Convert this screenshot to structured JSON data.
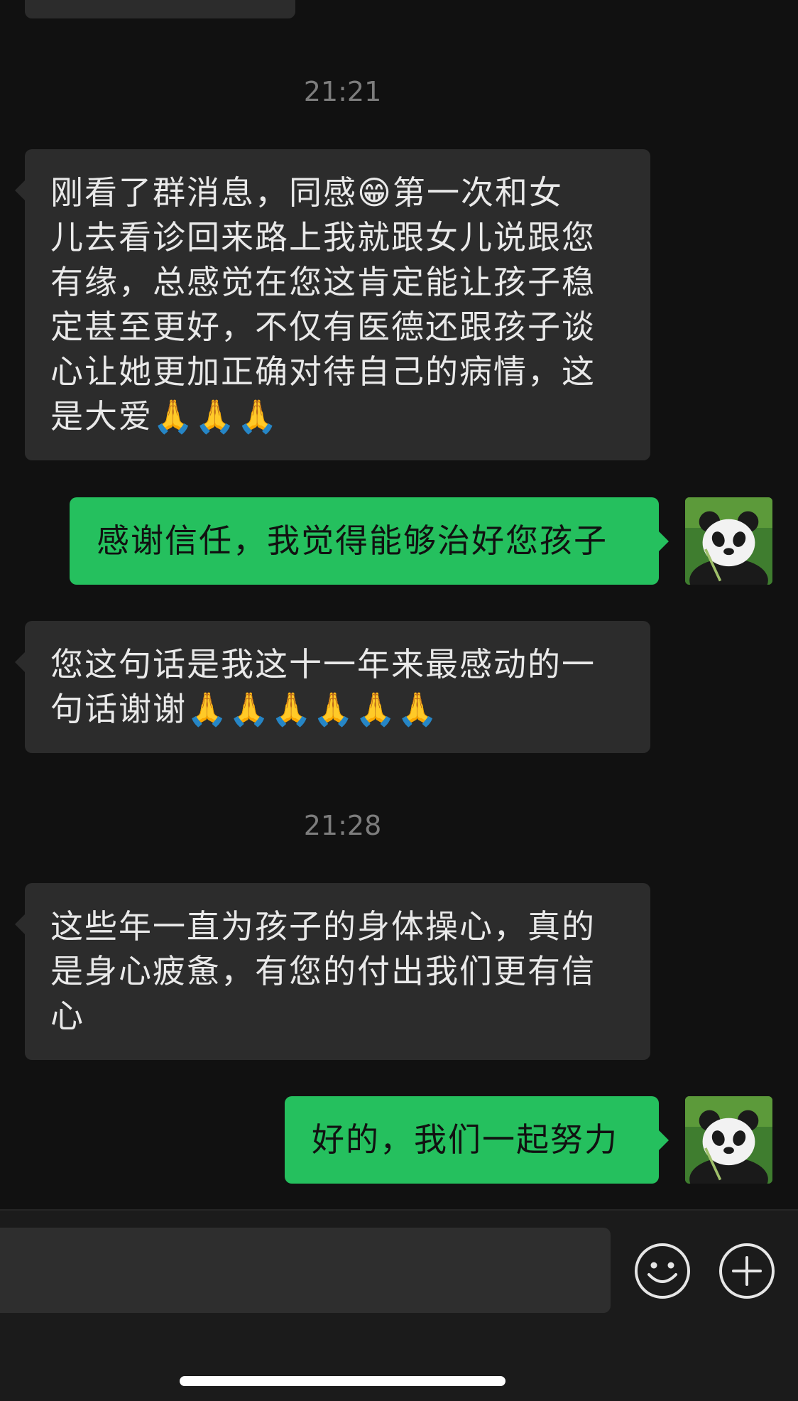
{
  "messages": [
    {
      "type": "timestamp",
      "text": "21:21"
    },
    {
      "type": "incoming",
      "lines": [
        "刚看了群消息，同感😁第一次和女",
        "儿去看诊回来路上我就跟女儿说跟您",
        "有缘，总感觉在您这肯定能让孩子稳",
        "定甚至更好，不仅有医德还跟孩子谈",
        "心让她更加正确对待自己的病情，这",
        "是大爱🙏🙏🙏"
      ]
    },
    {
      "type": "outgoing",
      "text": "感谢信任，我觉得能够治好您孩子",
      "avatar": "panda-avatar"
    },
    {
      "type": "incoming",
      "lines": [
        "您这句话是我这十一年来最感动的一",
        "句话谢谢🙏🙏🙏🙏🙏🙏"
      ]
    },
    {
      "type": "timestamp",
      "text": "21:28"
    },
    {
      "type": "incoming",
      "lines": [
        "这些年一直为孩子的身体操心，真的",
        "是身心疲惫，有您的付出我们更有信",
        "心"
      ]
    },
    {
      "type": "outgoing",
      "text": "好的，我们一起努力",
      "avatar": "panda-avatar"
    }
  ],
  "input_bar": {
    "input_value": "",
    "emoji_icon": "smiley-face-icon",
    "plus_icon": "plus-circle-icon"
  },
  "colors": {
    "background": "#111111",
    "incoming_bubble": "#2c2c2c",
    "outgoing_bubble": "#25c05e",
    "timestamp": "#7d7d7d"
  }
}
